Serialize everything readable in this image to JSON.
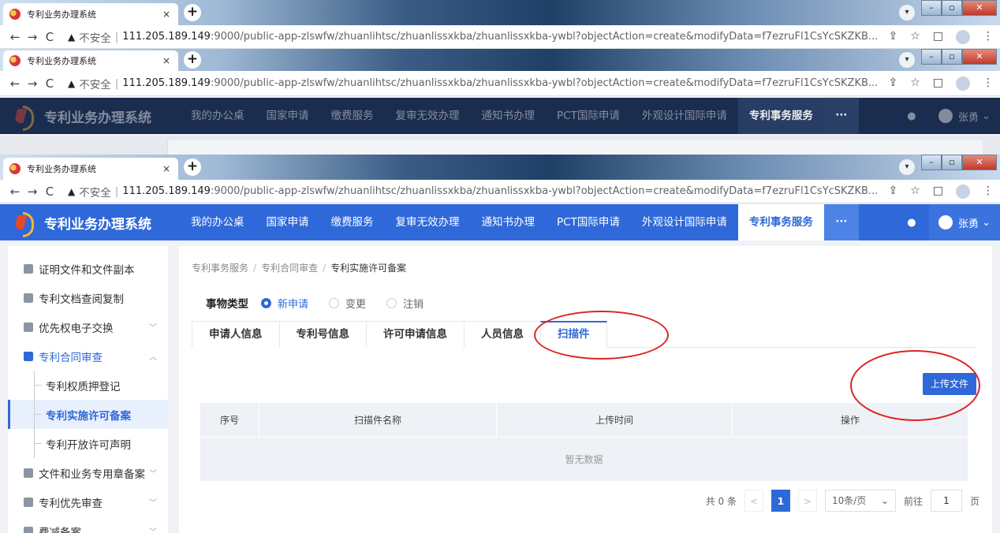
{
  "browser": {
    "tab_title": "专利业务办理系统",
    "tab_close": "×",
    "new_tab": "+",
    "insecure": "不安全",
    "separator": "|",
    "url_host": "111.205.189.149",
    "url_path": ":9000/public-app-zlswfw/zhuanlihtsc/zhuanlissxkba/zhuanlissxkba-ywbl?objectAction=create&modifyData=f7ezruFl1CsYcSKZKB...",
    "url_path_short": ":9000/public-app-zlswfw/zhuanlihtsc/zhuanlissxkba/zhuanlissxkba-ywbl?objectAction=create&modifyData=f7ezruFl1CsYcSKZKB..."
  },
  "app": {
    "title": "专利业务办理系统",
    "nav": [
      "我的办公桌",
      "国家申请",
      "缴费服务",
      "复审无效办理",
      "通知书办理",
      "PCT国际申请",
      "外观设计国际申请",
      "专利事务服务"
    ],
    "more": "···",
    "user": "张勇"
  },
  "sidebar": {
    "items": [
      {
        "label": "证明文件和文件副本"
      },
      {
        "label": "专利文档查阅复制"
      },
      {
        "label": "优先权电子交换"
      },
      {
        "label": "专利合同审查"
      }
    ],
    "subitems": [
      "专利权质押登记",
      "专利实施许可备案",
      "专利开放许可声明"
    ],
    "items_after": [
      {
        "label": "文件和业务专用章备案"
      },
      {
        "label": "专利优先审查"
      },
      {
        "label": "费减备案"
      }
    ]
  },
  "main": {
    "breadcrumb": [
      "专利事务服务",
      "专利合同审查",
      "专利实施许可备案"
    ],
    "type_label": "事物类型",
    "radios": [
      "新申请",
      "变更",
      "注销"
    ],
    "tabs": [
      "申请人信息",
      "专利号信息",
      "许可申请信息",
      "人员信息",
      "扫描件"
    ],
    "upload_label": "上传文件",
    "columns": [
      "序号",
      "扫描件名称",
      "上传时间",
      "操作"
    ],
    "empty": "暂无数据",
    "total": "共 0 条",
    "page": "1",
    "page_size": "10条/页",
    "goto": "前往",
    "goto_value": "1",
    "page_unit": "页"
  }
}
